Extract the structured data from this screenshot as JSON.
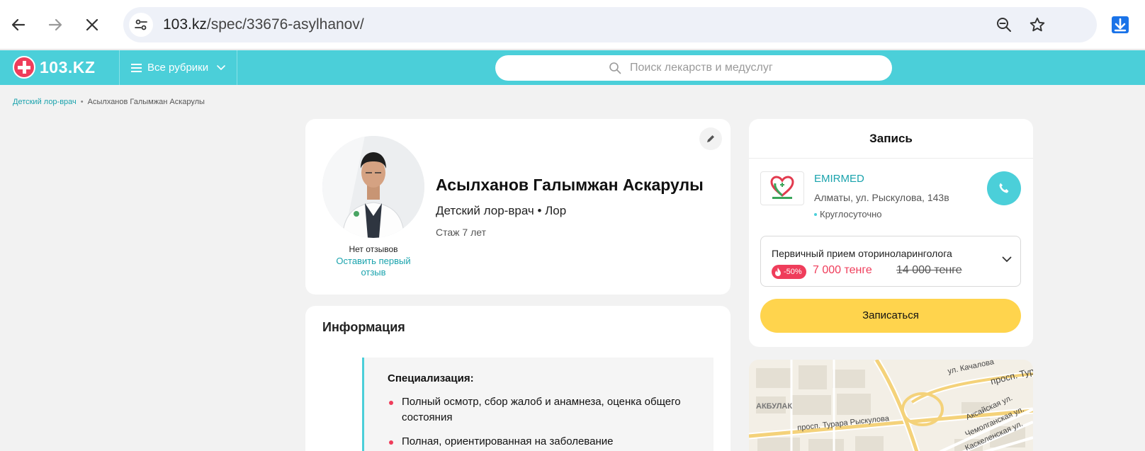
{
  "browser": {
    "url_host": "103.kz",
    "url_path": "/spec/33676-asylhanov/"
  },
  "site": {
    "logo_text": "103.KZ",
    "rubrics_label": "Все рубрики",
    "search_placeholder": "Поиск лекарств и медуслуг"
  },
  "breadcrumb": {
    "items": [
      "Детский лор-врач",
      "Асылханов Галымжан Аскарулы"
    ]
  },
  "doctor": {
    "name": "Асылханов Галымжан Аскарулы",
    "specialty": "Детский лор-врач • Лор",
    "experience": "Стаж 7 лет",
    "reviews_status": "Нет отзывов",
    "leave_review": "Оставить первый отзыв"
  },
  "info": {
    "title": "Информация",
    "specialization_heading": "Специализация:",
    "items": [
      "Полный осмотр, сбор жалоб и анамнеза, оценка общего состояния",
      "Полная, ориентированная на заболевание"
    ]
  },
  "booking": {
    "title": "Запись",
    "clinic_name": "EMIRMED",
    "clinic_address": "Алматы, ул. Рыскулова, 143в",
    "clinic_hours": "Круглосуточно",
    "service_name": "Первичный прием оториноларинголога",
    "discount": "-50%",
    "price_new": "7 000 тенге",
    "price_old": "14 000 тенге",
    "book_button": "Записаться"
  },
  "map": {
    "labels": [
      "ул. Качалова",
      "просп. Турар",
      "АКБУЛАК",
      "просп. Турара Рыскулова",
      "Аксайская ул.",
      "Чемолганская ул.",
      "Каскеленская ул."
    ]
  },
  "colors": {
    "brand_teal": "#4bcfd9",
    "accent_red": "#ef3d5b",
    "button_yellow": "#ffd44d"
  }
}
